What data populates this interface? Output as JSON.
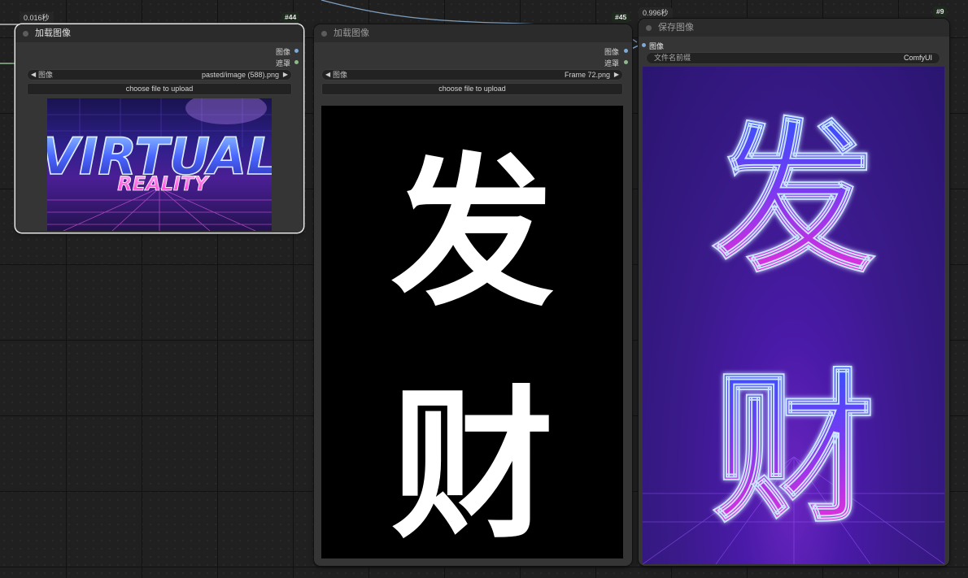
{
  "nodes": {
    "n44": {
      "id": "#44",
      "time": "0.016秒",
      "title": "加载图像",
      "outputs": [
        "图像",
        "遮罩"
      ],
      "image_widget": {
        "label": "图像",
        "value": "pasted/image (588).png"
      },
      "upload_label": "choose file to upload",
      "preview_text": {
        "line1": "VIRTUAL",
        "line2": "REALITY"
      }
    },
    "n45": {
      "id": "#45",
      "title": "加载图像",
      "outputs": [
        "图像",
        "遮罩"
      ],
      "image_widget": {
        "label": "图像",
        "value": "Frame 72.png"
      },
      "upload_label": "choose file to upload",
      "preview_text": {
        "char1": "发",
        "char2": "财"
      }
    },
    "n9": {
      "id": "#9",
      "time": "0.996秒",
      "title": "保存图像",
      "input": "图像",
      "prefix_widget": {
        "label": "文件名前缀",
        "value": "ComfyUI"
      },
      "preview_text": {
        "char1": "发",
        "char2": "财"
      }
    }
  },
  "colors": {
    "canvas": "#202020",
    "node_bg": "#353535",
    "image_wire": "#7fa9d6",
    "mask_wire": "#8fb88f",
    "neon_pink": "#ff2bd6",
    "neon_blue": "#3d6bff",
    "deep_purple": "#3a1a8a"
  }
}
